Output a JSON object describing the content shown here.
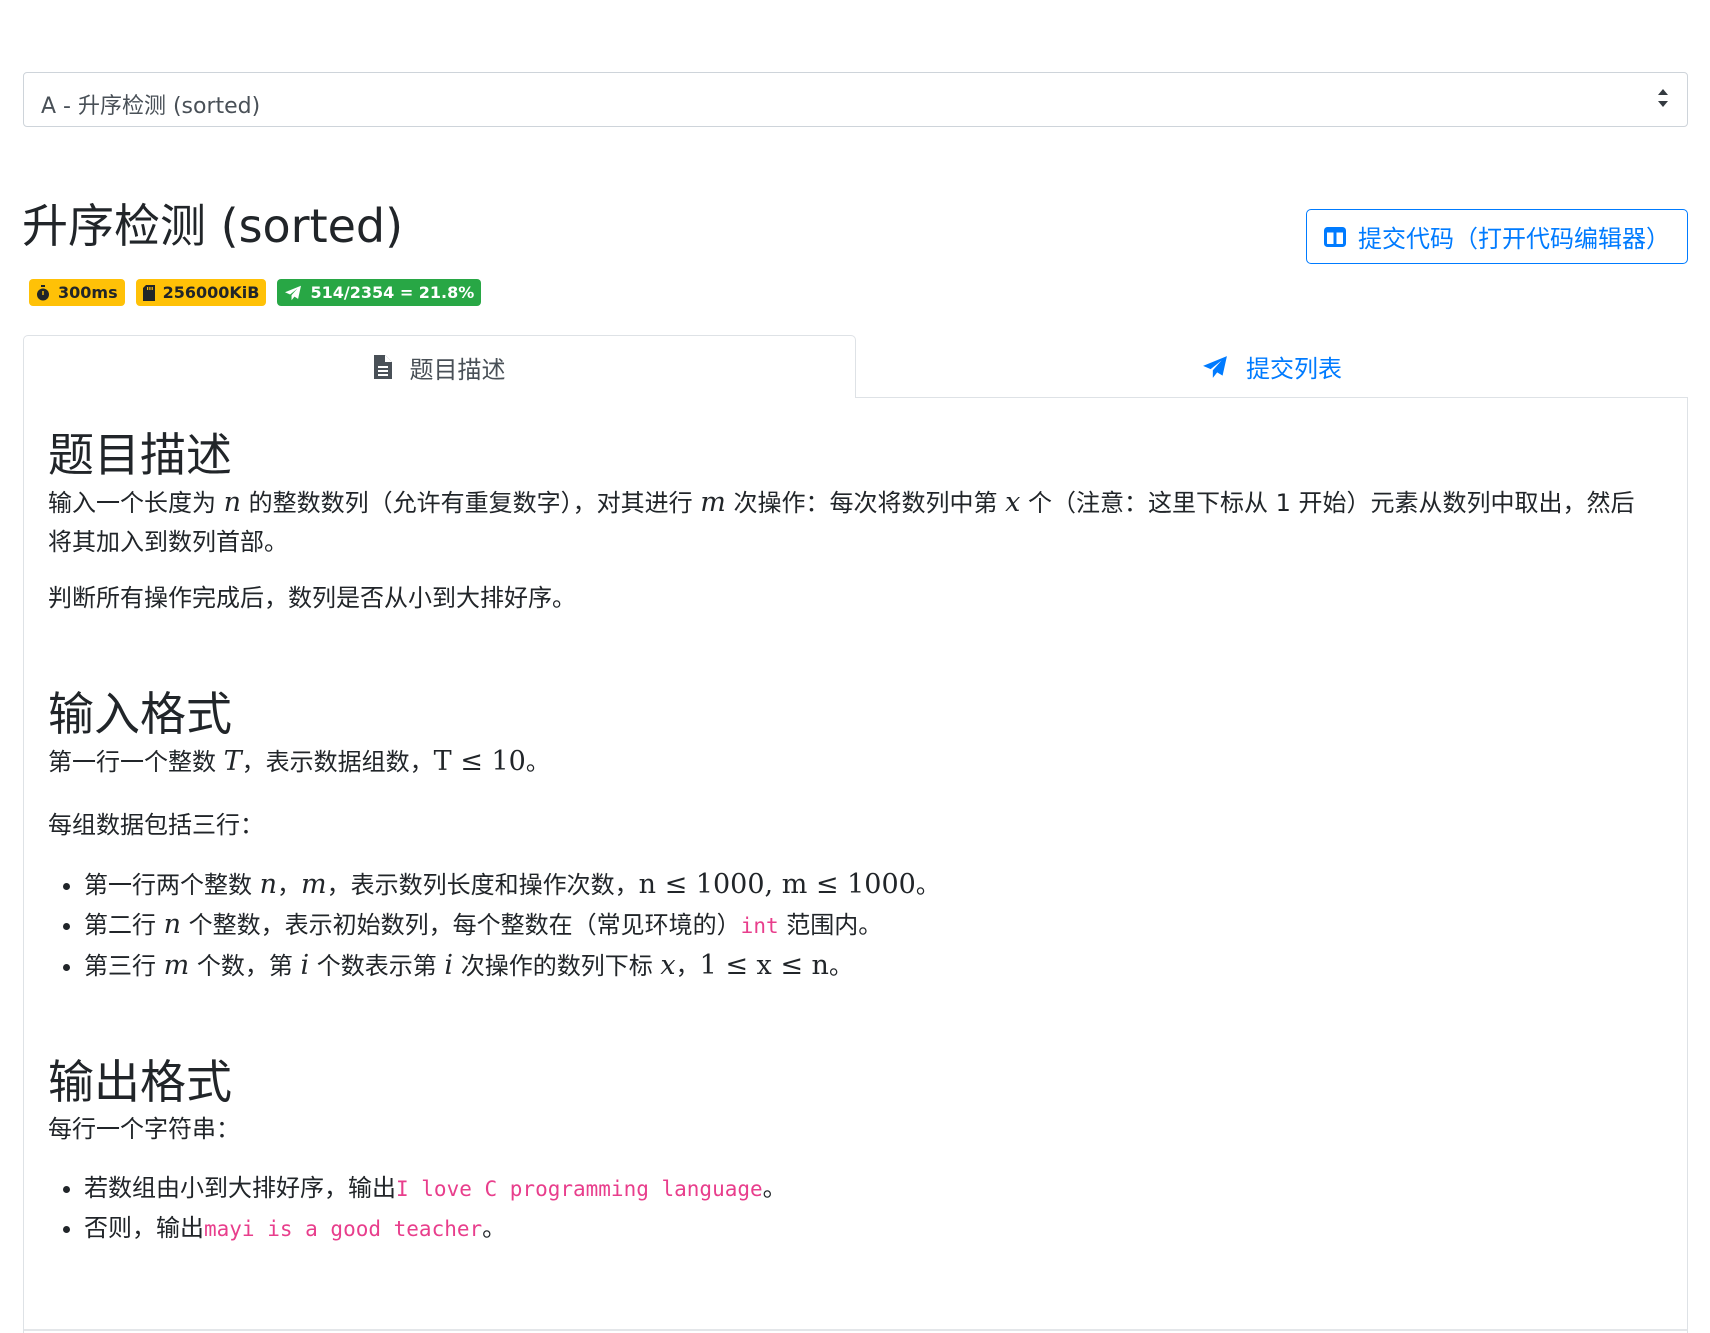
{
  "problem_select": {
    "selected": "A - 升序检测 (sorted)"
  },
  "header": {
    "title": "升序检测 (sorted)",
    "submit_label": "提交代码（打开代码编辑器）"
  },
  "badges": {
    "time_limit": "300ms",
    "memory_limit": "256000KiB",
    "acceptance": "514/2354 = 21.8%"
  },
  "tabs": [
    {
      "label": "题目描述"
    },
    {
      "label": "提交列表"
    }
  ],
  "description": {
    "heading": "题目描述",
    "p1": {
      "a": "输入一个长度为 ",
      "var_n": "n",
      "b": " 的整数数列（允许有重复数字），对其进行 ",
      "var_m": "m",
      "c": " 次操作：每次将数列中第 ",
      "var_x": "x",
      "d": " 个（注意：这里下标从 1 开始）元素从数列中取出，然后将其加入到数列首部。"
    },
    "p2": "判断所有操作完成后，数列是否从小到大排好序。"
  },
  "input_format": {
    "heading": "输入格式",
    "line1": {
      "a": "第一行一个整数 ",
      "var_T": "T",
      "b": "，表示数据组数，",
      "math": "T ≤ 10",
      "c": "。"
    },
    "line2": "每组数据包括三行：",
    "items": [
      {
        "a": "第一行两个整数 ",
        "v1": "n",
        "sep": "，",
        "v2": "m",
        "b": "，表示数列长度和操作次数，",
        "math": "n ≤ 1000, m ≤ 1000",
        "c": "。"
      },
      {
        "a": "第二行 ",
        "v1": "n",
        "b": " 个整数，表示初始数列，每个整数在（常见环境的）",
        "code": "int",
        "c": " 范围内。"
      },
      {
        "a": "第三行 ",
        "v1": "m",
        "b": " 个数，第 ",
        "v2": "i",
        "c": " 个数表示第 ",
        "v3": "i",
        "d": " 次操作的数列下标 ",
        "v4": "x",
        "e": "，",
        "math": "1 ≤ x ≤ n",
        "f": "。"
      }
    ]
  },
  "output_format": {
    "heading": "输出格式",
    "line1": "每行一个字符串：",
    "items": [
      {
        "a": "若数组由小到大排好序，输出",
        "code": "I love C programming language",
        "b": "。"
      },
      {
        "a": "否则，输出",
        "code": "mayi is a good teacher",
        "b": "。"
      }
    ]
  },
  "colors": {
    "primary": "#007bff",
    "warning": "#ffc107",
    "success": "#28a745",
    "code": "#e83e8c"
  }
}
